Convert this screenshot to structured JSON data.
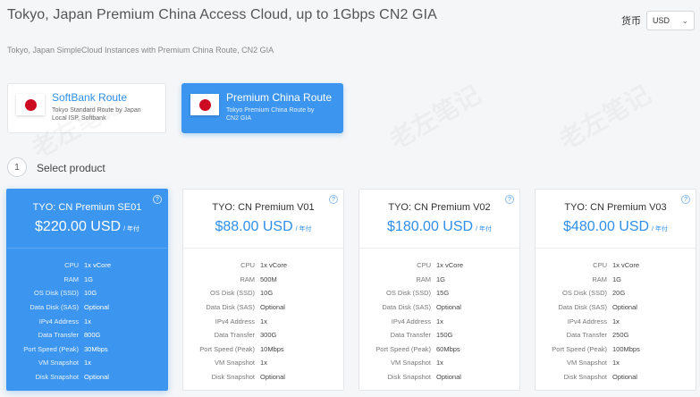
{
  "header": {
    "title": "Tokyo, Japan Premium China Access Cloud, up to 1Gbps CN2 GIA",
    "subtitle": "Tokyo, Japan SimpleCloud Instances with Premium China Route, CN2 GIA",
    "currency_label": "货币",
    "currency_value": "USD"
  },
  "routes": [
    {
      "name": "SoftBank Route",
      "desc": "Tokyo Standard Route by Japan Local ISP, Softbank",
      "flag_icon": "japan-flag-icon"
    },
    {
      "name": "Premium China Route",
      "desc": "Tokyo Premium China Route by CN2 GIA",
      "flag_icon": "japan-flag-icon"
    }
  ],
  "step": {
    "number": "1",
    "label": "Select product"
  },
  "spec_labels": [
    "CPU",
    "RAM",
    "OS Disk (SSD)",
    "Data Disk (SAS)",
    "IPv4 Address",
    "Data Transfer",
    "Port Speed (Peak)",
    "VM Snapshot",
    "Disk Snapshot"
  ],
  "products": [
    {
      "name": "TYO: CN Premium SE01",
      "price": "$220.00 USD",
      "unit": "/ 年付",
      "specs": [
        "1x vCore",
        "1G",
        "10G",
        "Optional",
        "1x",
        "800G",
        "30Mbps",
        "1x",
        "Optional"
      ]
    },
    {
      "name": "TYO: CN Premium V01",
      "price": "$88.00 USD",
      "unit": "/ 年付",
      "specs": [
        "1x vCore",
        "500M",
        "10G",
        "Optional",
        "1x",
        "300G",
        "10Mbps",
        "1x",
        "Optional"
      ]
    },
    {
      "name": "TYO: CN Premium V02",
      "price": "$180.00 USD",
      "unit": "/ 年付",
      "specs": [
        "1x vCore",
        "1G",
        "15G",
        "Optional",
        "1x",
        "150G",
        "60Mbps",
        "1x",
        "Optional"
      ]
    },
    {
      "name": "TYO: CN Premium V03",
      "price": "$480.00 USD",
      "unit": "/ 年付",
      "specs": [
        "1x vCore",
        "1G",
        "20G",
        "Optional",
        "1x",
        "250G",
        "100Mbps",
        "1x",
        "Optional"
      ]
    }
  ],
  "colors": {
    "accent": "#3c95ee",
    "flag_red": "#cc0a22"
  }
}
